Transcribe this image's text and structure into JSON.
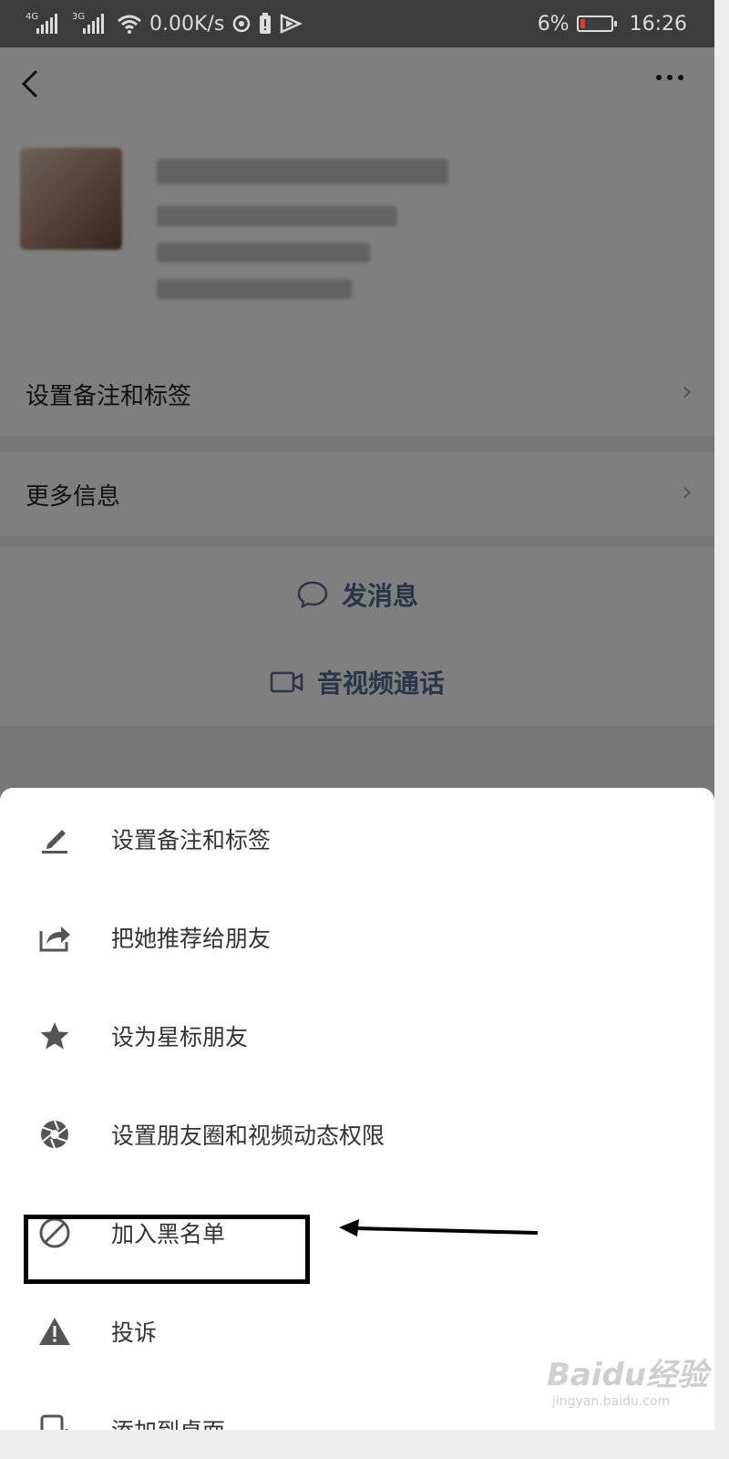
{
  "status_bar": {
    "signal1_label": "4G",
    "signal2_label": "3G",
    "net_speed": "0.00K/s",
    "battery_percent": "6%",
    "time": "16:26"
  },
  "header": {
    "back_icon": "chevron-left-icon",
    "more_icon": "more-icon"
  },
  "rows": {
    "remarks_label": "设置备注和标签",
    "more_info_label": "更多信息"
  },
  "actions": {
    "message_label": "发消息",
    "call_label": "音视频通话"
  },
  "sheet": {
    "items": [
      {
        "label": "设置备注和标签",
        "icon": "pencil-icon"
      },
      {
        "label": "把她推荐给朋友",
        "icon": "share-icon"
      },
      {
        "label": "设为星标朋友",
        "icon": "star-icon"
      },
      {
        "label": "设置朋友圈和视频动态权限",
        "icon": "aperture-icon"
      },
      {
        "label": "加入黑名单",
        "icon": "block-icon"
      },
      {
        "label": "投诉",
        "icon": "warning-icon"
      },
      {
        "label": "添加到桌面",
        "icon": "add-to-desktop-icon"
      }
    ]
  },
  "watermark": {
    "brand": "Baidu经验",
    "url": "jingyan.baidu.com"
  },
  "colors": {
    "link": "#576b95",
    "overlay": "rgba(0,0,0,0.5)",
    "sheet_bg": "#ffffff"
  }
}
